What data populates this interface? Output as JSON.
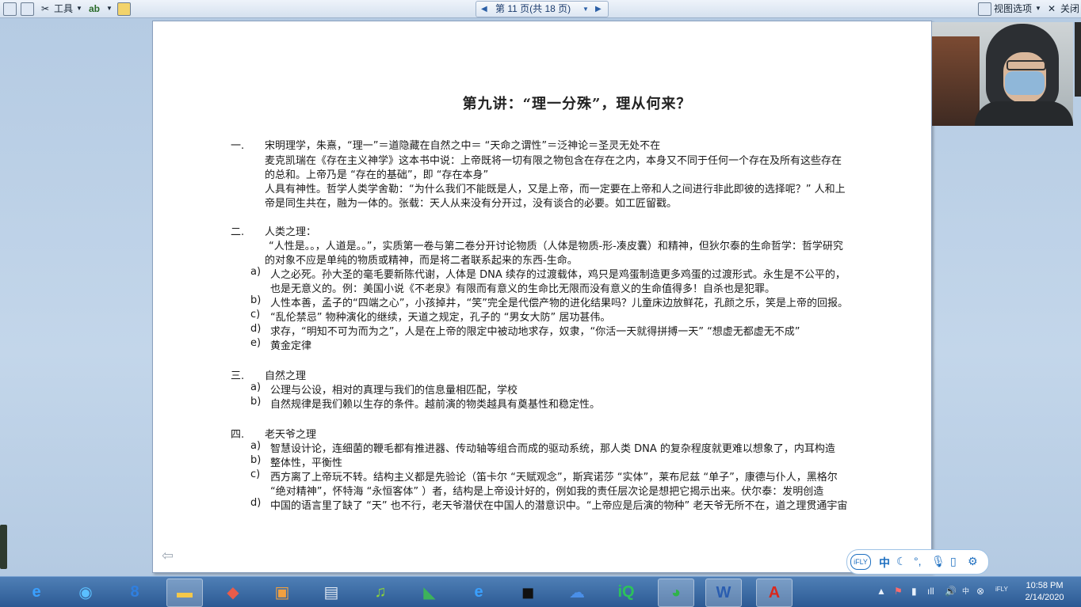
{
  "toolbar": {
    "tools_label": "工具",
    "page_indicator": "第 11 页(共 18 页)",
    "view_options_label": "视图选项",
    "close_label": "关闭"
  },
  "document": {
    "title": "第九讲：“理一分殊”，理从何来？",
    "lines": [
      {
        "num": "一.",
        "text": "宋明理学，朱熹，“理一”＝道隐藏在自然之中＝ “天命之谓性”＝泛神论＝圣灵无处不在"
      },
      {
        "num": "",
        "text": "麦克凯瑞在《存在主义神学》这本书中说：上帝既将一切有限之物包含在存在之内，本身又不同于任何一个存在及所有这些存在"
      },
      {
        "num": "",
        "text": "的总和。上帝乃是 “存在的基础”，即 “存在本身”"
      },
      {
        "num": "",
        "text": "人具有神性。哲学人类学舍勒：“为什么我们不能既是人，又是上帝，而一定要在上帝和人之间进行非此即彼的选择呢？” 人和上"
      },
      {
        "num": "",
        "text": "帝是同生共在，融为一体的。张载：天人从来没有分开过，没有谈合的必要。如工匠留戳。"
      },
      {
        "num": "二.",
        "text": "人类之理："
      },
      {
        "num": "",
        "text": "“人性是。。，人道是。。”，实质第一卷与第二卷分开讨论物质（人体是物质-形-凑皮囊）和精神，但狄尔泰的生命哲学：哲学研究"
      },
      {
        "num": "",
        "text": "的对象不应是单纯的物质或精神，而是将二者联系起来的东西-生命。"
      },
      {
        "num": "a)",
        "text": "人之必死。孙大圣的毫毛要新陈代谢，人体是 DNA 续存的过渡载体，鸡只是鸡蛋制造更多鸡蛋的过渡形式。永生是不公平的，"
      },
      {
        "num": "",
        "text": "也是无意义的。例：美国小说《不老泉》有限而有意义的生命比无限而没有意义的生命值得多！自杀也是犯罪。"
      },
      {
        "num": "b)",
        "text": "人性本善，孟子的“四端之心”，小孩掉井，“笑”完全是代偿产物的进化结果吗？儿童床边放鲜花，孔颜之乐，笑是上帝的回报。"
      },
      {
        "num": "c)",
        "text": "“乱伦禁忌” 物种演化的继续，天道之规定，孔子的 “男女大防” 居功甚伟。"
      },
      {
        "num": "d)",
        "text": "求存，“明知不可为而为之”，人是在上帝的限定中被动地求存，奴隶，“你活一天就得拼搏一天” “想虚无都虚无不成”"
      },
      {
        "num": "e)",
        "text": "黄金定律"
      },
      {
        "num": "三.",
        "text": "自然之理"
      },
      {
        "num": "a)",
        "text": "公理与公设，相对的真理与我们的信息量相匹配，学校"
      },
      {
        "num": "b)",
        "text": "自然规律是我们赖以生存的条件。越前演的物类越具有奠基性和稳定性。"
      },
      {
        "num": "四.",
        "text": "老天爷之理"
      },
      {
        "num": "a)",
        "text": "智慧设计论，连细菌的鞭毛都有推进器、传动轴等组合而成的驱动系统，那人类 DNA 的复杂程度就更难以想象了，内耳构造"
      },
      {
        "num": "b)",
        "text": "整体性，平衡性"
      },
      {
        "num": "c)",
        "text": "西方离了上帝玩不转。结构主义都是先验论（笛卡尔 “天赋观念”，斯宾诺莎 “实体”，莱布尼兹 “单子”，康德与仆人，黑格尔"
      },
      {
        "num": "",
        "text": "“绝对精神”，怀特海 “永恒客体” ）者，结构是上帝设计好的，例如我的责任层次论是想把它揭示出来。伏尔泰：发明创造"
      },
      {
        "num": "d)",
        "text": "中国的语言里了缺了 “天” 也不行，老天爷潜伏在中国人的潜意识中。“上帝应是后演的物种” 老天爷无所不在，道之理贯通宇宙"
      }
    ]
  },
  "ifly": {
    "logo": "iFLY",
    "lang": "中"
  },
  "taskbar": {
    "apps": [
      "ie-icon",
      "media-icon",
      "baidu-icon",
      "folder-icon",
      "store-icon",
      "package-icon",
      "film-icon",
      "music-icon",
      "pdf-reader-icon",
      "ie-icon",
      "camera-icon",
      "cloud-icon",
      "iqiyi-icon",
      "wechat-icon",
      "word-icon",
      "acrobat-icon"
    ],
    "time": "10:58 PM",
    "date": "2/14/2020"
  }
}
